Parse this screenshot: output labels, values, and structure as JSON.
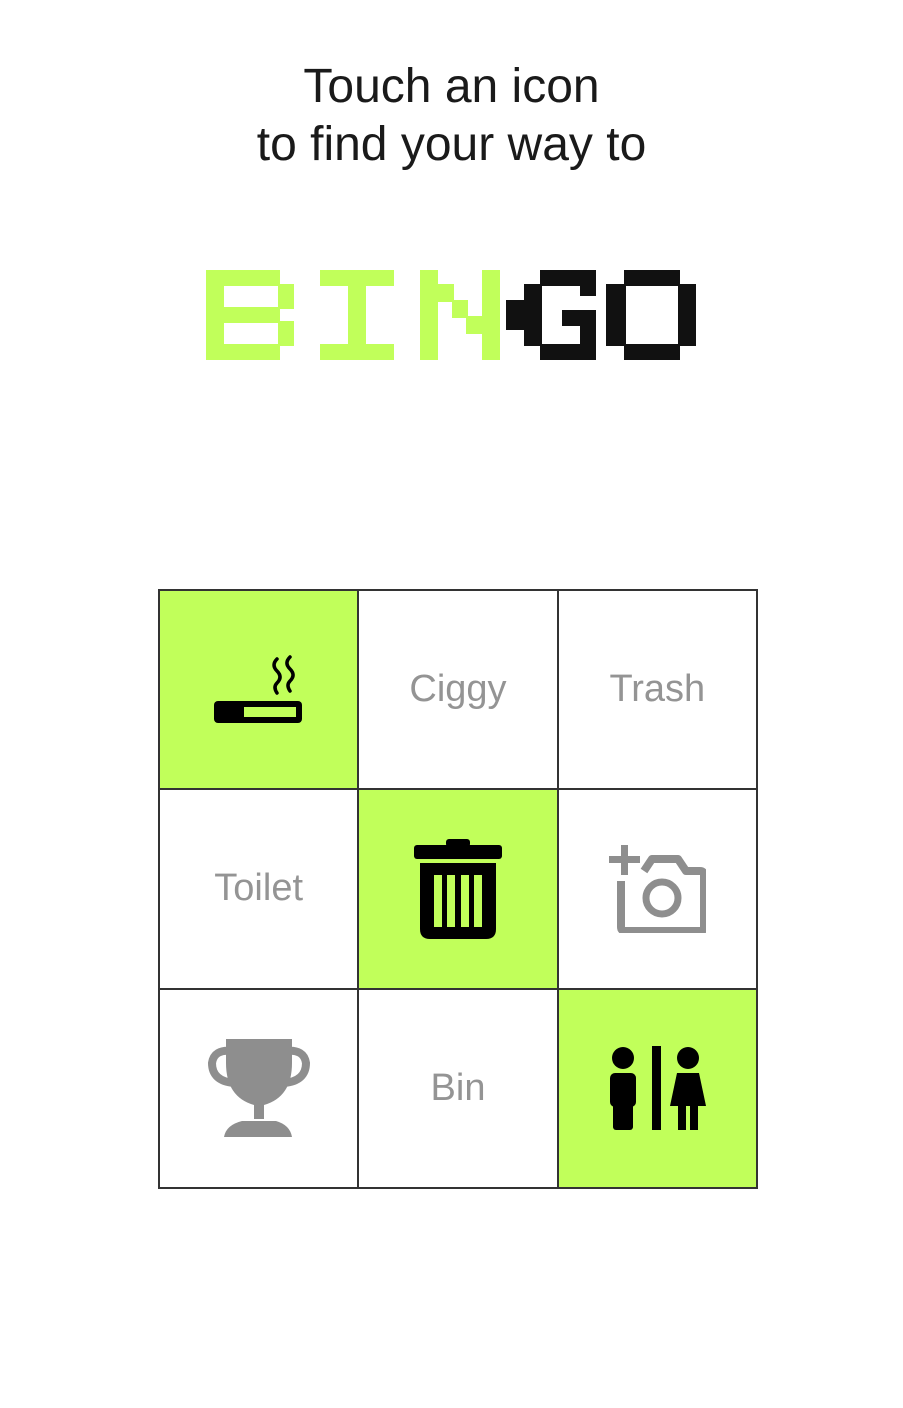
{
  "intro": {
    "line1": "Touch an icon",
    "line2": "to find your way to"
  },
  "logo": {
    "text": "BINGO",
    "highlighted_part": "BIN",
    "rest_part": "GO"
  },
  "colors": {
    "accent": "#c1ff5a",
    "dark": "#111111",
    "grey_text": "#949494",
    "grey_icon": "#8e8e8e",
    "grid_border": "#333333"
  },
  "grid": {
    "cells": [
      {
        "kind": "icon",
        "icon": "smoking-area-icon",
        "highlighted": true
      },
      {
        "kind": "label",
        "label": "Ciggy",
        "highlighted": false
      },
      {
        "kind": "label",
        "label": "Trash",
        "highlighted": false
      },
      {
        "kind": "label",
        "label": "Toilet",
        "highlighted": false
      },
      {
        "kind": "icon",
        "icon": "trash-can-icon",
        "highlighted": true
      },
      {
        "kind": "icon",
        "icon": "add-photo-icon",
        "highlighted": false
      },
      {
        "kind": "icon",
        "icon": "trophy-icon",
        "highlighted": false
      },
      {
        "kind": "label",
        "label": "Bin",
        "highlighted": false
      },
      {
        "kind": "icon",
        "icon": "restroom-icon",
        "highlighted": true
      }
    ]
  }
}
